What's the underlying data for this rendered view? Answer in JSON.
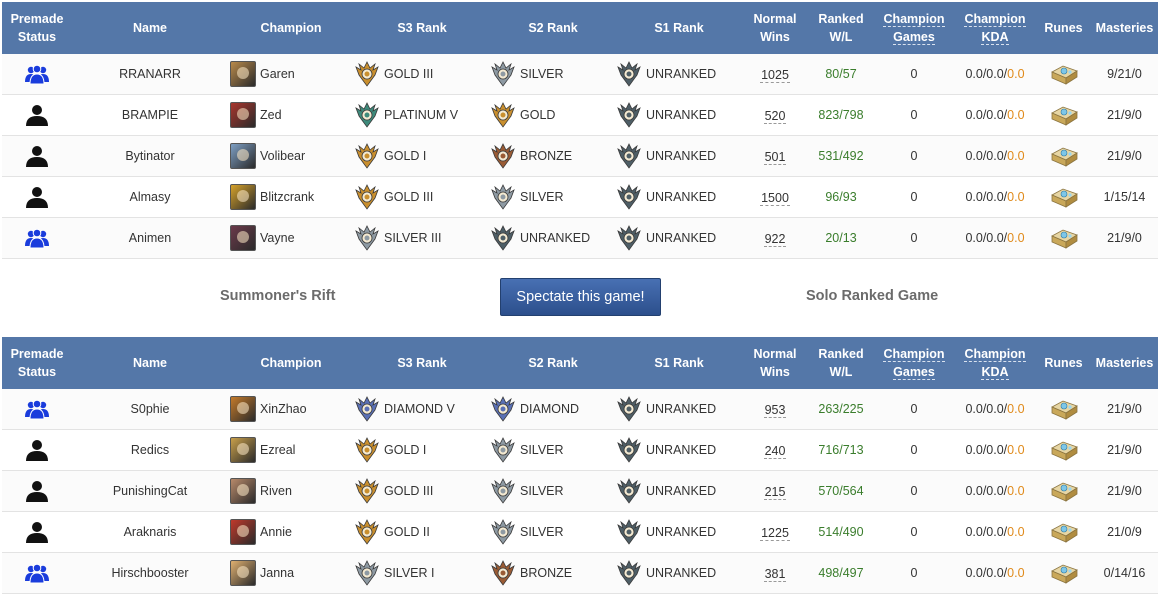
{
  "headers": {
    "premade": [
      "Premade",
      "Status"
    ],
    "name": "Name",
    "champion": "Champion",
    "s3": "S3 Rank",
    "s2": "S2 Rank",
    "s1": "S1 Rank",
    "normal_wins": [
      "Normal",
      "Wins"
    ],
    "ranked_wl": [
      "Ranked",
      "W/L"
    ],
    "champ_games": [
      "Champion",
      "Games"
    ],
    "champ_kda": [
      "Champion",
      "KDA"
    ],
    "runes": "Runes",
    "masteries": "Masteries"
  },
  "colors": {
    "header_bg": "#5477a8",
    "premade_icon": "#1a3cdc",
    "solo_icon": "#111111",
    "wl_green": "#3a7d2c",
    "kda_orange": "#e08a1a",
    "button_bg": "#35599a"
  },
  "rank_colors": {
    "GOLD": "#c98f2e",
    "SILVER": "#8e9aa3",
    "BRONZE": "#9a5b34",
    "PLATINUM": "#3e8a7b",
    "DIAMOND": "#5a70b5",
    "UNRANKED": "#4e5e66"
  },
  "team1": [
    {
      "premade": "premade",
      "name": "RRANARR",
      "champion": "Garen",
      "champ_color": "#b98a4a",
      "s3": "GOLD III",
      "s3_tier": "GOLD",
      "s2": "SILVER",
      "s2_tier": "SILVER",
      "s1": "UNRANKED",
      "s1_tier": "UNRANKED",
      "normal_wins": "1025",
      "ranked_wl": "80/57",
      "champ_games": "0",
      "kda_a": "0.0/0.0/",
      "kda_b": "0.0",
      "masteries": "9/21/0"
    },
    {
      "premade": "solo",
      "name": "BRAMPIE",
      "champion": "Zed",
      "champ_color": "#a8352c",
      "s3": "PLATINUM V",
      "s3_tier": "PLATINUM",
      "s2": "GOLD",
      "s2_tier": "GOLD",
      "s1": "UNRANKED",
      "s1_tier": "UNRANKED",
      "normal_wins": "520",
      "ranked_wl": "823/798",
      "champ_games": "0",
      "kda_a": "0.0/0.0/",
      "kda_b": "0.0",
      "masteries": "21/9/0"
    },
    {
      "premade": "solo",
      "name": "Bytinator",
      "champion": "Volibear",
      "champ_color": "#7d9fc4",
      "s3": "GOLD I",
      "s3_tier": "GOLD",
      "s2": "BRONZE",
      "s2_tier": "BRONZE",
      "s1": "UNRANKED",
      "s1_tier": "UNRANKED",
      "normal_wins": "501",
      "ranked_wl": "531/492",
      "champ_games": "0",
      "kda_a": "0.0/0.0/",
      "kda_b": "0.0",
      "masteries": "21/9/0"
    },
    {
      "premade": "solo",
      "name": "Almasy",
      "champion": "Blitzcrank",
      "champ_color": "#d6a22a",
      "s3": "GOLD III",
      "s3_tier": "GOLD",
      "s2": "SILVER",
      "s2_tier": "SILVER",
      "s1": "UNRANKED",
      "s1_tier": "UNRANKED",
      "normal_wins": "1500",
      "ranked_wl": "96/93",
      "champ_games": "0",
      "kda_a": "0.0/0.0/",
      "kda_b": "0.0",
      "masteries": "1/15/14"
    },
    {
      "premade": "premade",
      "name": "Animen",
      "champion": "Vayne",
      "champ_color": "#6b3a4a",
      "s3": "SILVER III",
      "s3_tier": "SILVER",
      "s2": "UNRANKED",
      "s2_tier": "UNRANKED",
      "s1": "UNRANKED",
      "s1_tier": "UNRANKED",
      "normal_wins": "922",
      "ranked_wl": "20/13",
      "champ_games": "0",
      "kda_a": "0.0/0.0/",
      "kda_b": "0.0",
      "masteries": "21/9/0"
    }
  ],
  "team2": [
    {
      "premade": "premade",
      "name": "S0phie",
      "champion": "XinZhao",
      "champ_color": "#c47a2a",
      "s3": "DIAMOND V",
      "s3_tier": "DIAMOND",
      "s2": "DIAMOND",
      "s2_tier": "DIAMOND",
      "s1": "UNRANKED",
      "s1_tier": "UNRANKED",
      "normal_wins": "953",
      "ranked_wl": "263/225",
      "champ_games": "0",
      "kda_a": "0.0/0.0/",
      "kda_b": "0.0",
      "masteries": "21/9/0"
    },
    {
      "premade": "solo",
      "name": "Redics",
      "champion": "Ezreal",
      "champ_color": "#c9a04a",
      "s3": "GOLD I",
      "s3_tier": "GOLD",
      "s2": "SILVER",
      "s2_tier": "SILVER",
      "s1": "UNRANKED",
      "s1_tier": "UNRANKED",
      "normal_wins": "240",
      "ranked_wl": "716/713",
      "champ_games": "0",
      "kda_a": "0.0/0.0/",
      "kda_b": "0.0",
      "masteries": "21/9/0"
    },
    {
      "premade": "solo",
      "name": "PunishingCat",
      "champion": "Riven",
      "champ_color": "#b98a6a",
      "s3": "GOLD III",
      "s3_tier": "GOLD",
      "s2": "SILVER",
      "s2_tier": "SILVER",
      "s1": "UNRANKED",
      "s1_tier": "UNRANKED",
      "normal_wins": "215",
      "ranked_wl": "570/564",
      "champ_games": "0",
      "kda_a": "0.0/0.0/",
      "kda_b": "0.0",
      "masteries": "21/9/0"
    },
    {
      "premade": "solo",
      "name": "Araknaris",
      "champion": "Annie",
      "champ_color": "#c0392b",
      "s3": "GOLD II",
      "s3_tier": "GOLD",
      "s2": "SILVER",
      "s2_tier": "SILVER",
      "s1": "UNRANKED",
      "s1_tier": "UNRANKED",
      "normal_wins": "1225",
      "ranked_wl": "514/490",
      "champ_games": "0",
      "kda_a": "0.0/0.0/",
      "kda_b": "0.0",
      "masteries": "21/0/9"
    },
    {
      "premade": "premade",
      "name": "Hirschbooster",
      "champion": "Janna",
      "champ_color": "#e0b070",
      "s3": "SILVER I",
      "s3_tier": "SILVER",
      "s2": "BRONZE",
      "s2_tier": "BRONZE",
      "s1": "UNRANKED",
      "s1_tier": "UNRANKED",
      "normal_wins": "381",
      "ranked_wl": "498/497",
      "champ_games": "0",
      "kda_a": "0.0/0.0/",
      "kda_b": "0.0",
      "masteries": "0/14/16"
    }
  ],
  "game": {
    "map": "Summoner's Rift",
    "spectate_label": "Spectate this game!",
    "queue": "Solo Ranked Game"
  },
  "icons": {
    "premade": "premade-group-icon",
    "solo": "solo-player-icon",
    "runes": "rune-book-icon",
    "rank": "rank-emblem-icon"
  }
}
